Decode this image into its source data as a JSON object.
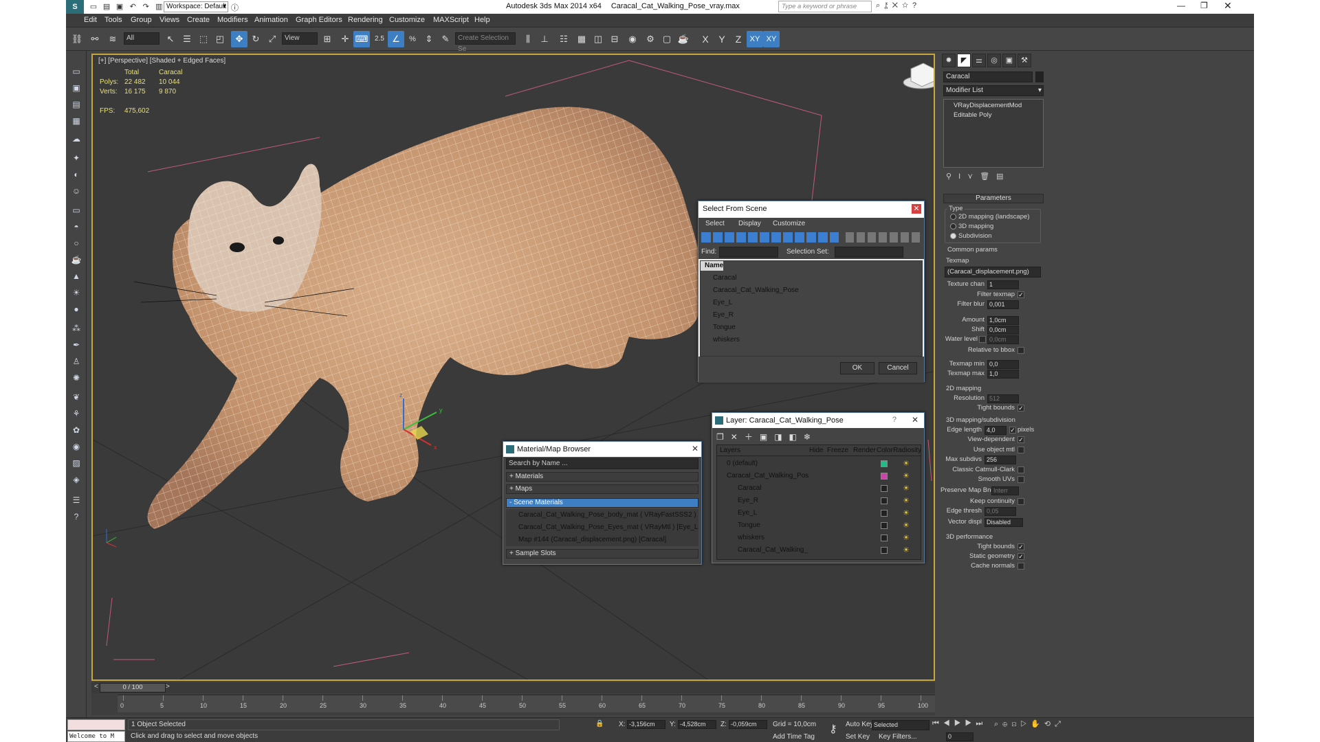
{
  "window": {
    "app_title": "Autodesk 3ds Max  2014 x64",
    "file_title": "Caracal_Cat_Walking_Pose_vray.max",
    "workspace_label": "Workspace: Default",
    "search_placeholder": "Type a keyword or phrase"
  },
  "menu": [
    "Edit",
    "Tools",
    "Group",
    "Views",
    "Create",
    "Modifiers",
    "Animation",
    "Graph Editors",
    "Rendering",
    "Customize",
    "MAXScript",
    "Help"
  ],
  "toolbar": {
    "filter_value": "All",
    "refcoord_value": "View",
    "snap_label": "2.5",
    "percent_label": "%",
    "named_selection_placeholder": "Create Selection Se",
    "axis_x": "X",
    "axis_y": "Y",
    "axis_z": "Z",
    "axis_xy": "XY",
    "axis_xy2": "XY"
  },
  "viewport": {
    "label": "[+] [Perspective] [Shaded + Edged Faces]",
    "stats": {
      "col_total": "Total",
      "col_obj": "Caracal",
      "polys_label": "Polys:",
      "polys_total": "22 482",
      "polys_obj": "10 044",
      "verts_label": "Verts:",
      "verts_total": "16 175",
      "verts_obj": "9 870",
      "fps_label": "FPS:",
      "fps_value": "475,602"
    },
    "gizmo_x": "x",
    "gizmo_y": "y",
    "gizmo_z": "z"
  },
  "select_dialog": {
    "title": "Select From Scene",
    "menus": [
      "Select",
      "Display",
      "Customize"
    ],
    "find_label": "Find:",
    "selset_label": "Selection Set:",
    "column_name": "Name",
    "items": [
      "Caracal",
      "Caracal_Cat_Walking_Pose",
      "Eye_L",
      "Eye_R",
      "Tongue",
      "whiskers"
    ],
    "ok": "OK",
    "cancel": "Cancel"
  },
  "material_browser": {
    "title": "Material/Map Browser",
    "search_placeholder": "Search by Name ...",
    "groups": [
      "+ Materials",
      "+ Maps",
      "- Scene Materials"
    ],
    "entries": [
      "Caracal_Cat_Walking_Pose_body_mat  ( VRayFastSSS2 )  [Carac...",
      "Caracal_Cat_Walking_Pose_Eyes_mat  ( VRayMtl )  [Eye_L, Eye...",
      "Map #144 (Caracal_displacement.png)  [Caracal]"
    ],
    "sample_slots": "+ Sample Slots"
  },
  "layer_dialog": {
    "title": "Layer: Caracal_Cat_Walking_Pose",
    "help": "?",
    "columns": [
      "Layers",
      "Hide",
      "Freeze",
      "Render",
      "Color",
      "Radiosity"
    ],
    "rows": [
      {
        "name": "0 (default)",
        "color": "#22bb88",
        "indent": 0
      },
      {
        "name": "Caracal_Cat_Walking_Pos",
        "color": "#cc44aa",
        "indent": 0
      },
      {
        "name": "Caracal",
        "color": "#222222",
        "indent": 1
      },
      {
        "name": "Eye_R",
        "color": "#222222",
        "indent": 1
      },
      {
        "name": "Eye_L",
        "color": "#222222",
        "indent": 1
      },
      {
        "name": "Tongue",
        "color": "#222222",
        "indent": 1
      },
      {
        "name": "whiskers",
        "color": "#222222",
        "indent": 1
      },
      {
        "name": "Caracal_Cat_Walking_",
        "color": "#222222",
        "indent": 1
      }
    ]
  },
  "command_panel": {
    "object_name": "Caracal",
    "modifier_list": "Modifier List",
    "stack": [
      "VRayDisplacementMod",
      "Editable Poly"
    ],
    "params_title": "Parameters",
    "type_label": "Type",
    "type_options": [
      "2D mapping (landscape)",
      "3D mapping",
      "Subdivision"
    ],
    "common_params": "Common params",
    "texmap_label": "Texmap",
    "texmap_value": "(Caracal_displacement.png)",
    "texture_chan_label": "Texture chan",
    "texture_chan_value": "1",
    "filter_texmap": "Filter texmap",
    "filter_blur_label": "Filter blur",
    "filter_blur_value": "0,001",
    "amount_label": "Amount",
    "amount_value": "1,0cm",
    "shift_label": "Shift",
    "shift_value": "0,0cm",
    "water_level_label": "Water level",
    "water_level_value": "0,0cm",
    "relative_bbox": "Relative to bbox",
    "texmap_min_label": "Texmap min",
    "texmap_min_value": "0,0",
    "texmap_max_label": "Texmap max",
    "texmap_max_value": "1,0",
    "map2d_title": "2D mapping",
    "resolution_label": "Resolution",
    "resolution_value": "512",
    "tight_bounds": "Tight bounds",
    "map3d_title": "3D mapping/subdivision",
    "edge_length_label": "Edge length",
    "edge_length_value": "4,0",
    "pixels_label": "pixels",
    "view_dependent": "View-dependent",
    "use_object_mtl": "Use object mtl",
    "max_subdivs_label": "Max subdivs",
    "max_subdivs_value": "256",
    "classic_catmull": "Classic Catmull-Clark",
    "smooth_uvs": "Smooth UVs",
    "preserve_map_bnd_label": "Preserve Map Bnd",
    "preserve_map_bnd_value": "Interr",
    "keep_continuity": "Keep continuity",
    "edge_thresh_label": "Edge thresh",
    "edge_thresh_value": "0,05",
    "vector_displ_label": "Vector displ",
    "vector_displ_value": "Disabled",
    "perf_title": "3D performance",
    "perf_tight_bounds": "Tight bounds",
    "static_geometry": "Static geometry",
    "cache_normals": "Cache normals"
  },
  "timeline": {
    "frame_counter": "0 / 100",
    "ticks": [
      "0",
      "5",
      "10",
      "15",
      "20",
      "25",
      "30",
      "35",
      "40",
      "45",
      "50",
      "55",
      "60",
      "65",
      "70",
      "75",
      "80",
      "85",
      "90",
      "95",
      "100"
    ]
  },
  "status": {
    "listener": "Welcome to M",
    "selection": "1 Object Selected",
    "prompt": "Click and drag to select and move objects",
    "x_label": "X:",
    "x_value": "-3,156cm",
    "y_label": "Y:",
    "y_value": "-4,528cm",
    "z_label": "Z:",
    "z_value": "-0,059cm",
    "grid": "Grid = 10,0cm",
    "add_time_tag": "Add Time Tag",
    "auto_key": "Auto Key",
    "set_key": "Set Key",
    "selected": "Selected",
    "key_filters": "Key Filters...",
    "frame": "0"
  }
}
